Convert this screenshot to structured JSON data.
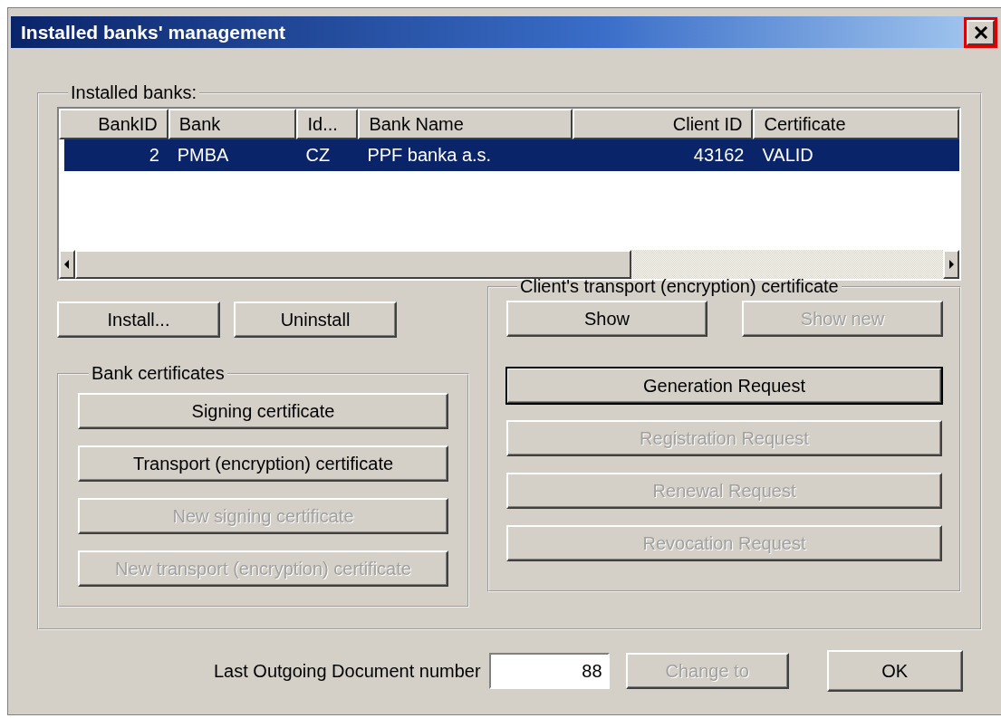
{
  "window": {
    "title": "Installed banks' management",
    "close_button": {
      "highlighted": true
    }
  },
  "installed_banks": {
    "label": "Installed banks:",
    "columns": [
      {
        "label": "BankID",
        "kind": "number"
      },
      {
        "label": "Bank",
        "kind": "text"
      },
      {
        "label": "Id...",
        "kind": "text"
      },
      {
        "label": "Bank Name",
        "kind": "text"
      },
      {
        "label": "Client ID",
        "kind": "number"
      },
      {
        "label": "Certificate",
        "kind": "text"
      }
    ],
    "rows": [
      {
        "cells": [
          "2",
          "PMBA",
          "CZ",
          "PPF banka a.s.",
          "43162",
          "VALID"
        ],
        "selected": true
      }
    ],
    "buttons": [
      {
        "label": "Install...",
        "disabled": false
      },
      {
        "label": "Uninstall",
        "disabled": false
      }
    ]
  },
  "bank_certificates": {
    "label": "Bank certificates",
    "buttons": [
      {
        "label": "Signing certificate",
        "disabled": false
      },
      {
        "label": "Transport (encryption) certificate",
        "disabled": false
      },
      {
        "label": "New signing certificate",
        "disabled": true
      },
      {
        "label": "New transport (encryption) certificate",
        "disabled": true
      }
    ]
  },
  "client_certificate": {
    "label": "Client's transport (encryption) certificate",
    "top_buttons": [
      {
        "label": "Show",
        "disabled": false
      },
      {
        "label": "Show new",
        "disabled": true
      }
    ],
    "buttons": [
      {
        "label": "Generation Request",
        "disabled": false,
        "default": true
      },
      {
        "label": "Registration Request",
        "disabled": true,
        "default": false
      },
      {
        "label": "Renewal Request",
        "disabled": true,
        "default": false
      },
      {
        "label": "Revocation Request",
        "disabled": true,
        "default": false
      }
    ]
  },
  "footer": {
    "label": "Last Outgoing Document number",
    "value": "88",
    "change_button": {
      "label": "Change to",
      "disabled": true
    },
    "ok_button": {
      "label": "OK",
      "disabled": false
    }
  }
}
